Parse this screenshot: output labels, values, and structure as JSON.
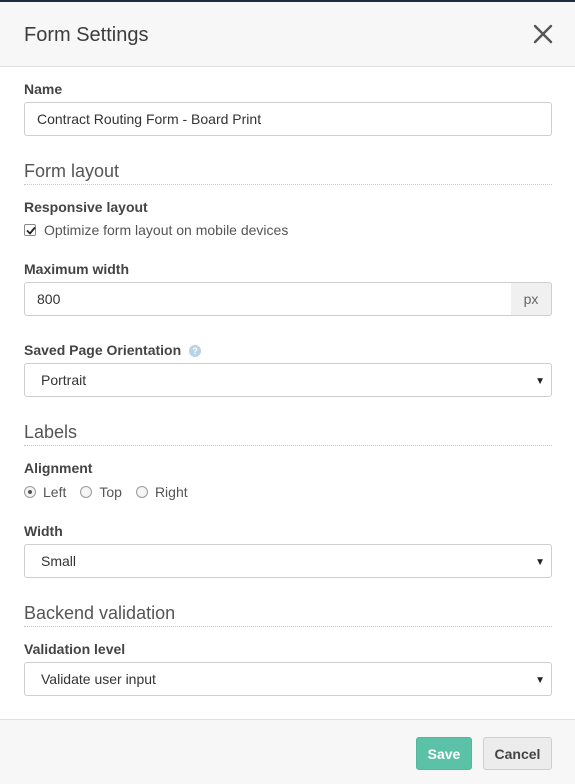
{
  "dialog": {
    "title": "Form Settings"
  },
  "name": {
    "label": "Name",
    "value": "Contract Routing Form - Board Print"
  },
  "form_layout": {
    "heading": "Form layout",
    "responsive_label": "Responsive layout",
    "responsive_checkbox_label": "Optimize form layout on mobile devices",
    "responsive_checked": true,
    "max_width_label": "Maximum width",
    "max_width_value": "800",
    "max_width_unit": "px",
    "orientation_label": "Saved Page Orientation",
    "orientation_help": "?",
    "orientation_value": "Portrait"
  },
  "labels": {
    "heading": "Labels",
    "alignment_label": "Alignment",
    "alignment_options": [
      "Left",
      "Top",
      "Right"
    ],
    "alignment_selected": "Left",
    "width_label": "Width",
    "width_value": "Small"
  },
  "backend_validation": {
    "heading": "Backend validation",
    "level_label": "Validation level",
    "level_value": "Validate user input"
  },
  "footer": {
    "save_label": "Save",
    "cancel_label": "Cancel"
  },
  "colors": {
    "save": "#5cc2a7",
    "header_bg": "#f7f7f7",
    "help_icon": "#b9d3e6"
  }
}
